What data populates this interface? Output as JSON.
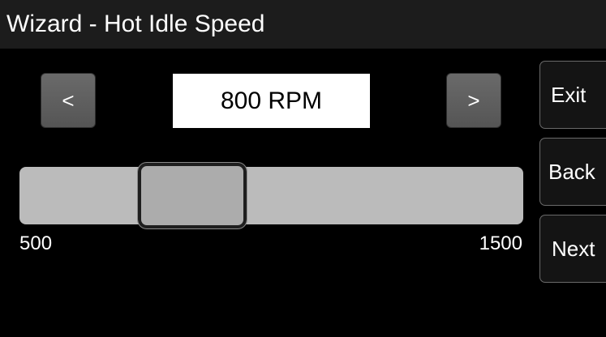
{
  "window": {
    "title": "Wizard - Hot Idle Speed"
  },
  "stepper": {
    "decrease_label": "<",
    "increase_label": ">",
    "value_display": "800 RPM"
  },
  "slider": {
    "min_label": "500",
    "max_label": "1500",
    "min": 500,
    "max": 1500,
    "value": 800
  },
  "side_buttons": {
    "exit_label": "Exit",
    "back_label": "Back",
    "next_label": "Next"
  },
  "colors": {
    "background": "#000000",
    "title_bar": "#1c1c1c",
    "track": "#bbbbbb",
    "thumb": "#acacac",
    "button": "#606060",
    "value_box": "#ffffff"
  }
}
